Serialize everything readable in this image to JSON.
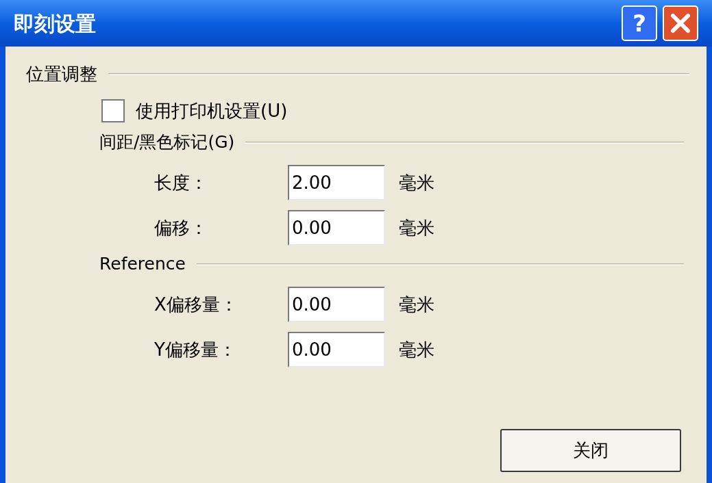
{
  "window": {
    "title": "即刻设置",
    "help_button": "?"
  },
  "section": {
    "title": "位置调整"
  },
  "use_printer_settings": {
    "label": "使用打印机设置(U)",
    "checked": false
  },
  "groups": [
    {
      "title": "间距/黑色标记(G)",
      "fields": [
        {
          "label": "长度：",
          "value": "2.00",
          "unit": "毫米"
        },
        {
          "label": "偏移：",
          "value": "0.00",
          "unit": "毫米"
        }
      ]
    },
    {
      "title": "Reference",
      "fields": [
        {
          "label": "X偏移量：",
          "value": "0.00",
          "unit": "毫米"
        },
        {
          "label": "Y偏移量：",
          "value": "0.00",
          "unit": "毫米"
        }
      ]
    }
  ],
  "buttons": [
    "关闭"
  ]
}
